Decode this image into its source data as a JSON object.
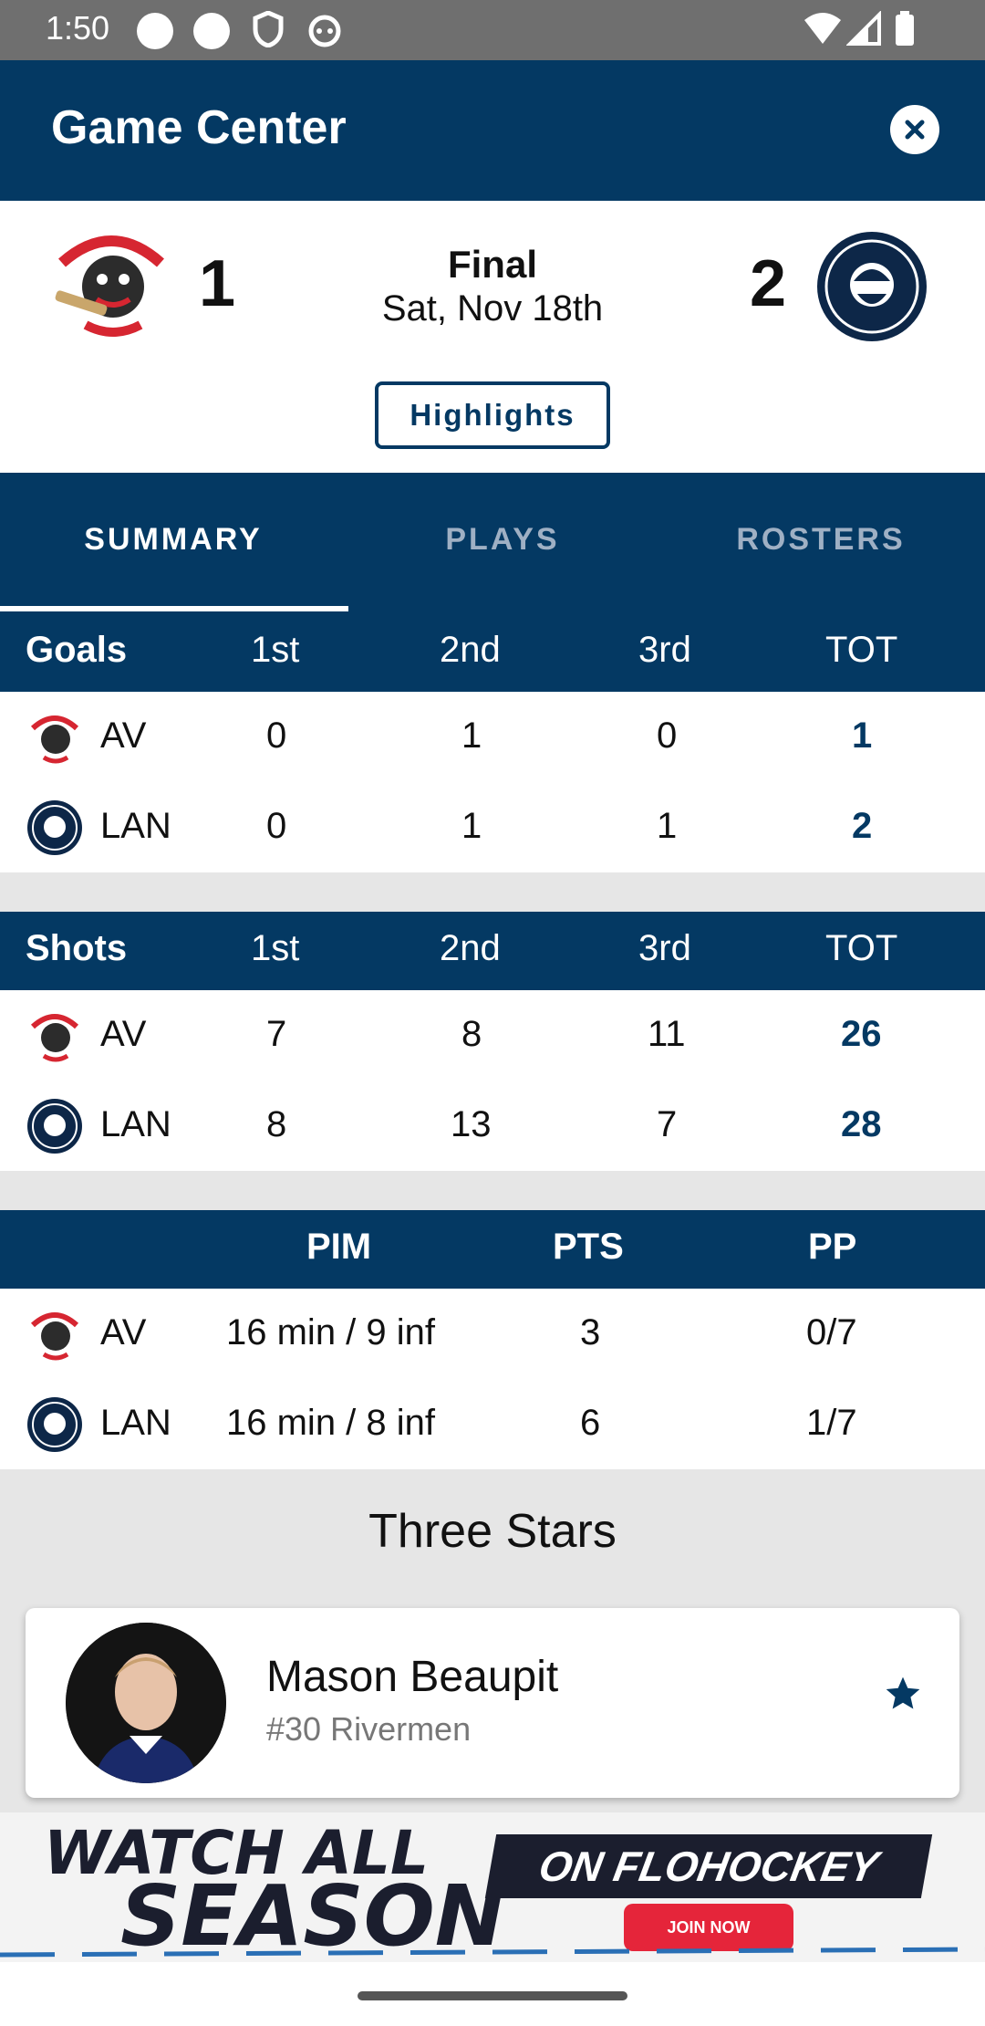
{
  "status_bar": {
    "time": "1:50"
  },
  "header": {
    "title": "Game Center"
  },
  "game": {
    "home_team_abbr": "AV",
    "away_team_abbr": "LAN",
    "home_score": "1",
    "away_score": "2",
    "status": "Final",
    "date": "Sat, Nov 18th",
    "highlights_label": "Highlights"
  },
  "tabs": [
    {
      "label": "SUMMARY",
      "active": true
    },
    {
      "label": "PLAYS",
      "active": false
    },
    {
      "label": "ROSTERS",
      "active": false
    }
  ],
  "goals_table": {
    "columns": [
      "Goals",
      "1st",
      "2nd",
      "3rd",
      "TOT"
    ],
    "rows": [
      {
        "team": "AV",
        "p1": "0",
        "p2": "1",
        "p3": "0",
        "tot": "1"
      },
      {
        "team": "LAN",
        "p1": "0",
        "p2": "1",
        "p3": "1",
        "tot": "2"
      }
    ]
  },
  "shots_table": {
    "columns": [
      "Shots",
      "1st",
      "2nd",
      "3rd",
      "TOT"
    ],
    "rows": [
      {
        "team": "AV",
        "p1": "7",
        "p2": "8",
        "p3": "11",
        "tot": "26"
      },
      {
        "team": "LAN",
        "p1": "8",
        "p2": "13",
        "p3": "7",
        "tot": "28"
      }
    ]
  },
  "stats_table": {
    "columns": [
      "",
      "PIM",
      "PTS",
      "PP"
    ],
    "rows": [
      {
        "team": "AV",
        "pim": "16 min / 9 inf",
        "pts": "3",
        "pp": "0/7"
      },
      {
        "team": "LAN",
        "pim": "16 min / 8 inf",
        "pts": "6",
        "pp": "1/7"
      }
    ]
  },
  "three_stars": {
    "title": "Three Stars",
    "players": [
      {
        "name": "Mason Beaupit",
        "info": "#30 Rivermen"
      }
    ]
  },
  "ad": {
    "line1": "WATCH ALL",
    "line2": "SEASON",
    "brand": "ON FLOHOCKEY",
    "cta": "JOIN NOW"
  },
  "colors": {
    "primary": "#043963",
    "background": "#e6e6e6",
    "accent_red": "#e5253a"
  }
}
